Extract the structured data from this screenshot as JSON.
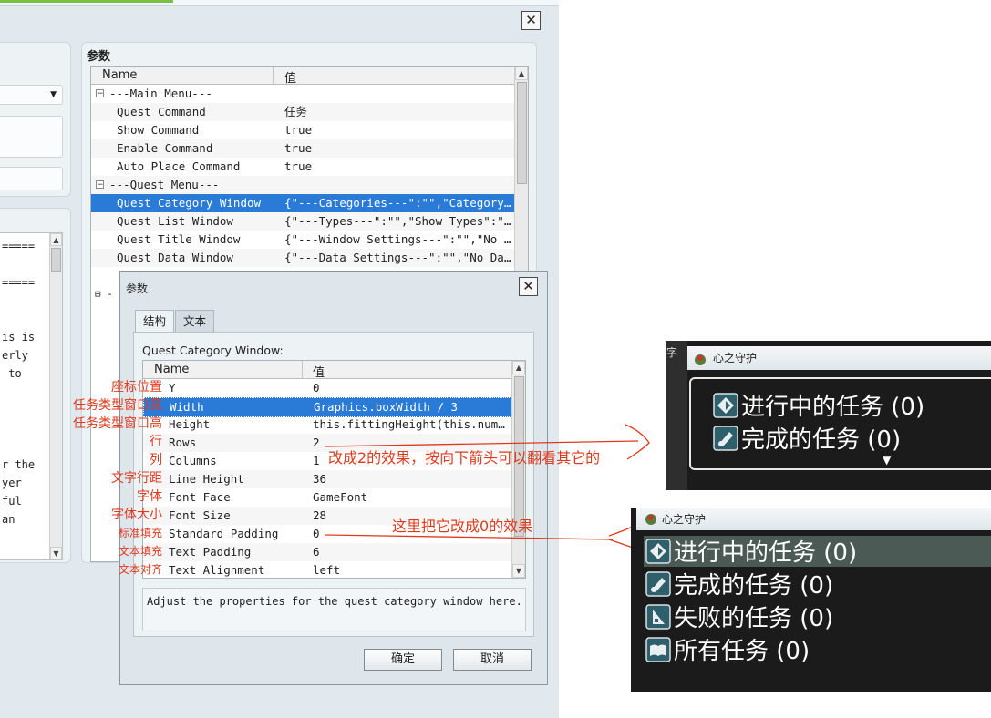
{
  "outer_dialog": {
    "close_glyph": "✕",
    "section_title": "参数",
    "columns": {
      "name": "Name",
      "value": "值"
    },
    "rows": [
      {
        "name": "---Main Menu---",
        "value": "",
        "group": true,
        "toggle": "⊟"
      },
      {
        "name": "Quest Command",
        "value": "任务"
      },
      {
        "name": "Show Command",
        "value": "true"
      },
      {
        "name": "Enable Command",
        "value": "true"
      },
      {
        "name": "Auto Place Command",
        "value": "true"
      },
      {
        "name": "---Quest Menu---",
        "value": "",
        "group": true,
        "toggle": "⊟"
      },
      {
        "name": "Quest Category Window",
        "value": "{\"---Categories---\":\"\",\"Category O…",
        "selected": true
      },
      {
        "name": "Quest List Window",
        "value": "{\"---Types---\":\"\",\"Show Types\":\"tr…"
      },
      {
        "name": "Quest Title Window",
        "value": "{\"---Window Settings---\":\"\",\"No Qu…"
      },
      {
        "name": "Quest Data Window",
        "value": "{\"---Data Settings---\":\"\",\"No Data…"
      }
    ],
    "partial_toggle": "⊟ -",
    "left_text_lines": [
      "=====",
      "",
      "=====",
      "",
      "",
      "is is",
      "erly",
      " to",
      "",
      "",
      "",
      "",
      "r the",
      "yer",
      "ful",
      "an"
    ]
  },
  "inner_dialog": {
    "title": "参数",
    "close_glyph": "✕",
    "tabs": [
      {
        "label": "结构",
        "active": true
      },
      {
        "label": "文本",
        "active": false
      }
    ],
    "section_label": "Quest Category Window:",
    "columns": {
      "name": "Name",
      "value": "值"
    },
    "rows": [
      {
        "name": "Y",
        "value": "0"
      },
      {
        "name": "Width",
        "value": "Graphics.boxWidth / 3",
        "selected": true
      },
      {
        "name": "Height",
        "value": "this.fittingHeight(this.numVi…"
      },
      {
        "name": "Rows",
        "value": "2"
      },
      {
        "name": "Columns",
        "value": "1"
      },
      {
        "name": "Line Height",
        "value": "36"
      },
      {
        "name": "Font Face",
        "value": "GameFont"
      },
      {
        "name": "Font Size",
        "value": "28"
      },
      {
        "name": "Standard Padding",
        "value": "0"
      },
      {
        "name": "Text Padding",
        "value": "6"
      },
      {
        "name": "Text Alignment",
        "value": "left"
      }
    ],
    "description": "Adjust the properties for the quest category window here.",
    "ok_label": "确定",
    "cancel_label": "取消"
  },
  "annotations": {
    "row_labels": [
      "座标位置",
      "任务类型窗口宽",
      "任务类型窗口高",
      "行",
      "列",
      "文字行距",
      "字体",
      "字体大小",
      "标准填充",
      "文本填充",
      "文本对齐"
    ],
    "rows_note": "改成2的效果，按向下箭头可以翻看其它的",
    "padding_note": "这里把它改成0的效果",
    "color": "#e03a1e"
  },
  "game_preview_top": {
    "title": "心之守护",
    "edge_char": "字",
    "items": [
      {
        "icon": "compass-quest-icon",
        "label": "进行中的任务 (0)"
      },
      {
        "icon": "scroll-quest-icon",
        "label": "完成的任务 (0)"
      }
    ],
    "more_arrow": "▼"
  },
  "game_preview_bottom": {
    "title": "心之守护",
    "items": [
      {
        "icon": "compass-quest-icon",
        "label": "进行中的任务 (0)"
      },
      {
        "icon": "scroll-quest-icon",
        "label": "完成的任务 (0)"
      },
      {
        "icon": "failed-quest-icon",
        "label": "失败的任务 (0)"
      },
      {
        "icon": "book-quest-icon",
        "label": "所有任务 (0)"
      }
    ]
  }
}
